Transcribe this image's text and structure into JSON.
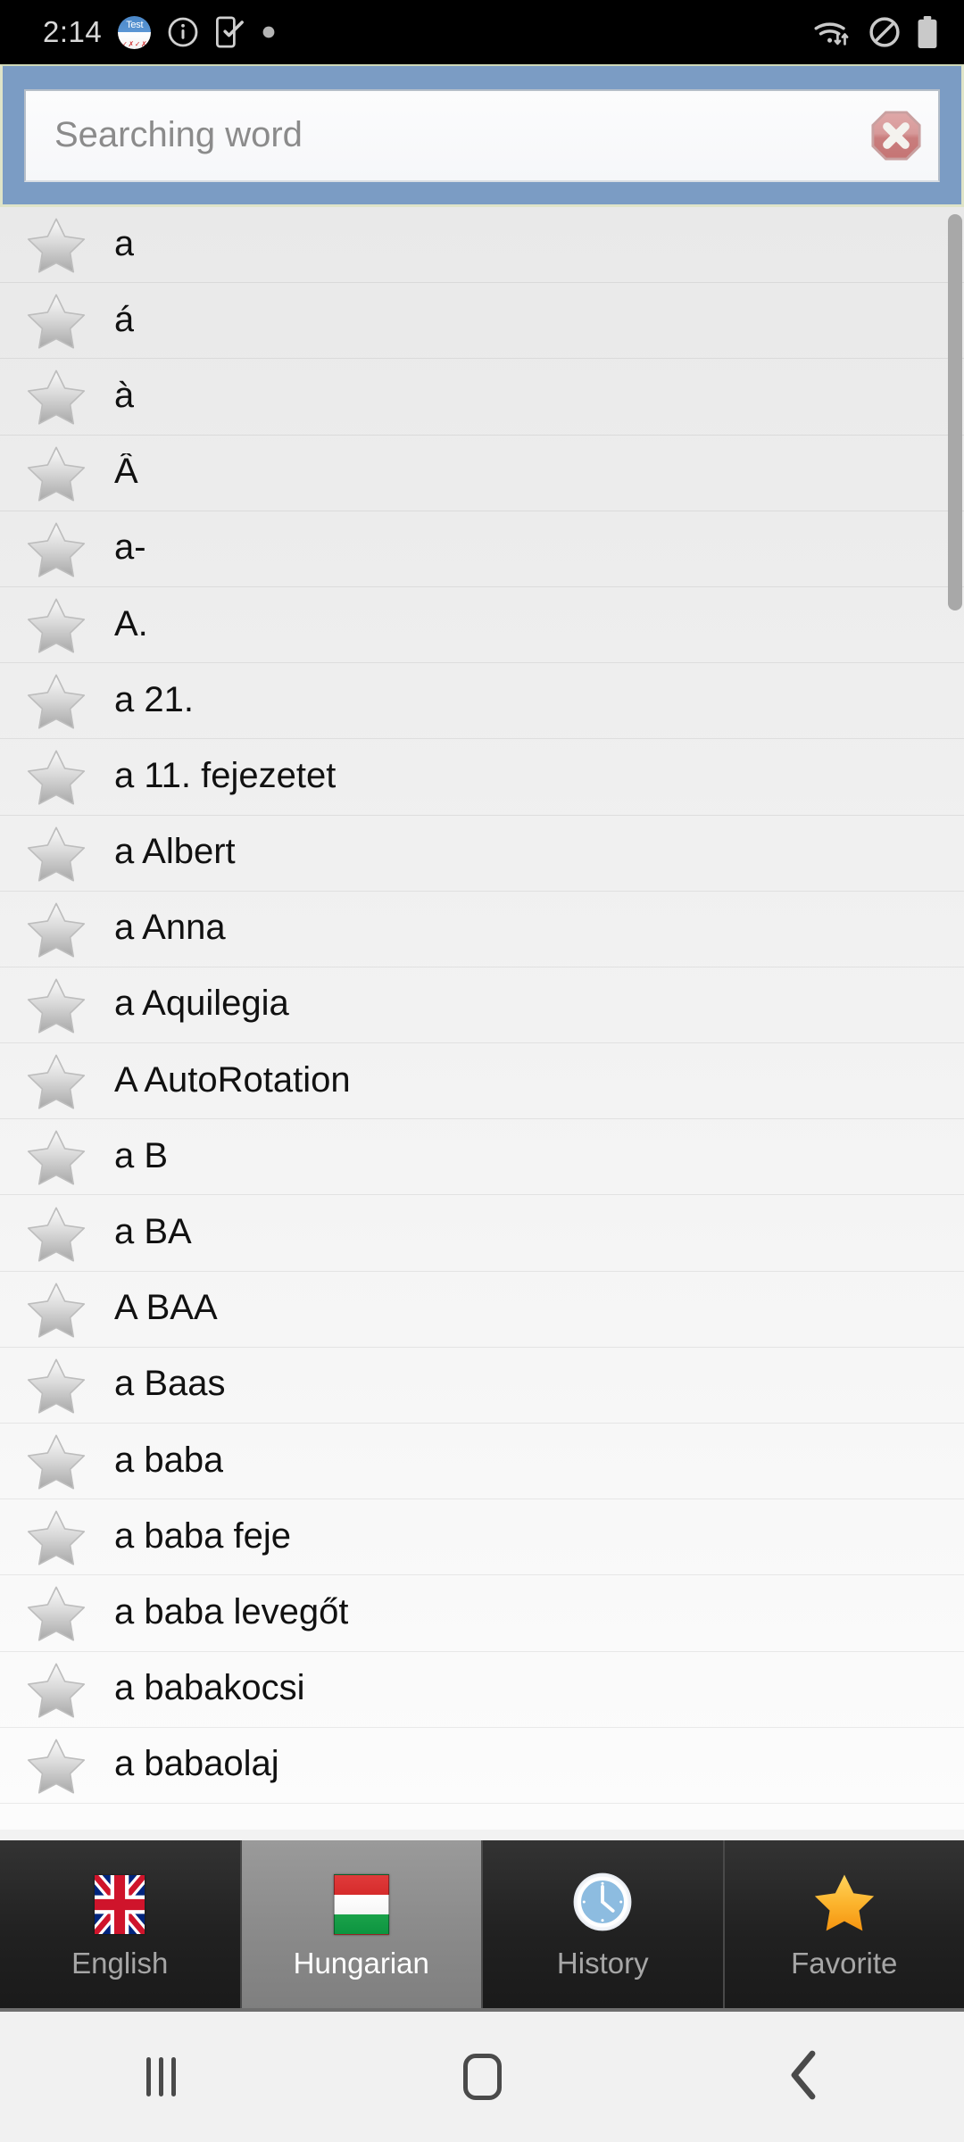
{
  "status_bar": {
    "time": "2:14",
    "left_icons": [
      {
        "name": "app-test-badge-icon",
        "text": "Test",
        "marks": "✓✗✓✗"
      },
      {
        "name": "info-circle-icon"
      },
      {
        "name": "phone-check-icon"
      },
      {
        "name": "dot-indicator-icon"
      }
    ],
    "right_icons": [
      {
        "name": "wifi-data-transfer-icon"
      },
      {
        "name": "do-not-disturb-icon"
      },
      {
        "name": "battery-icon"
      }
    ]
  },
  "search": {
    "placeholder": "Searching word",
    "value": "",
    "clear_label": "",
    "header_color": "#7b9cc4",
    "clear_color": "#c06a6a"
  },
  "list": {
    "items": [
      {
        "word": "a"
      },
      {
        "word": "á"
      },
      {
        "word": "à"
      },
      {
        "word": "Â"
      },
      {
        "word": "a-"
      },
      {
        "word": "A."
      },
      {
        "word": "a 21."
      },
      {
        "word": "a 11. fejezetet"
      },
      {
        "word": "a Albert"
      },
      {
        "word": "a Anna"
      },
      {
        "word": "a Aquilegia"
      },
      {
        "word": "A AutoRotation"
      },
      {
        "word": "a B"
      },
      {
        "word": "a BA"
      },
      {
        "word": "A BAA"
      },
      {
        "word": "a Baas"
      },
      {
        "word": "a baba"
      },
      {
        "word": "a baba feje"
      },
      {
        "word": "a baba levegőt"
      },
      {
        "word": "a babakocsi"
      },
      {
        "word": "a babaolaj"
      }
    ],
    "star_icon": "star-outline-gray-icon",
    "scrollbar_color": "#a8a8a8"
  },
  "tabs": [
    {
      "label": "English",
      "icon": "uk-flag-icon",
      "selected": false
    },
    {
      "label": "Hungarian",
      "icon": "hungary-flag-icon",
      "selected": true
    },
    {
      "label": "History",
      "icon": "clock-icon",
      "selected": false
    },
    {
      "label": "Favorite",
      "icon": "star-gold-icon",
      "selected": false
    }
  ],
  "nav_bar": {
    "recents_label": "Recents",
    "home_label": "Home",
    "back_label": "Back"
  }
}
